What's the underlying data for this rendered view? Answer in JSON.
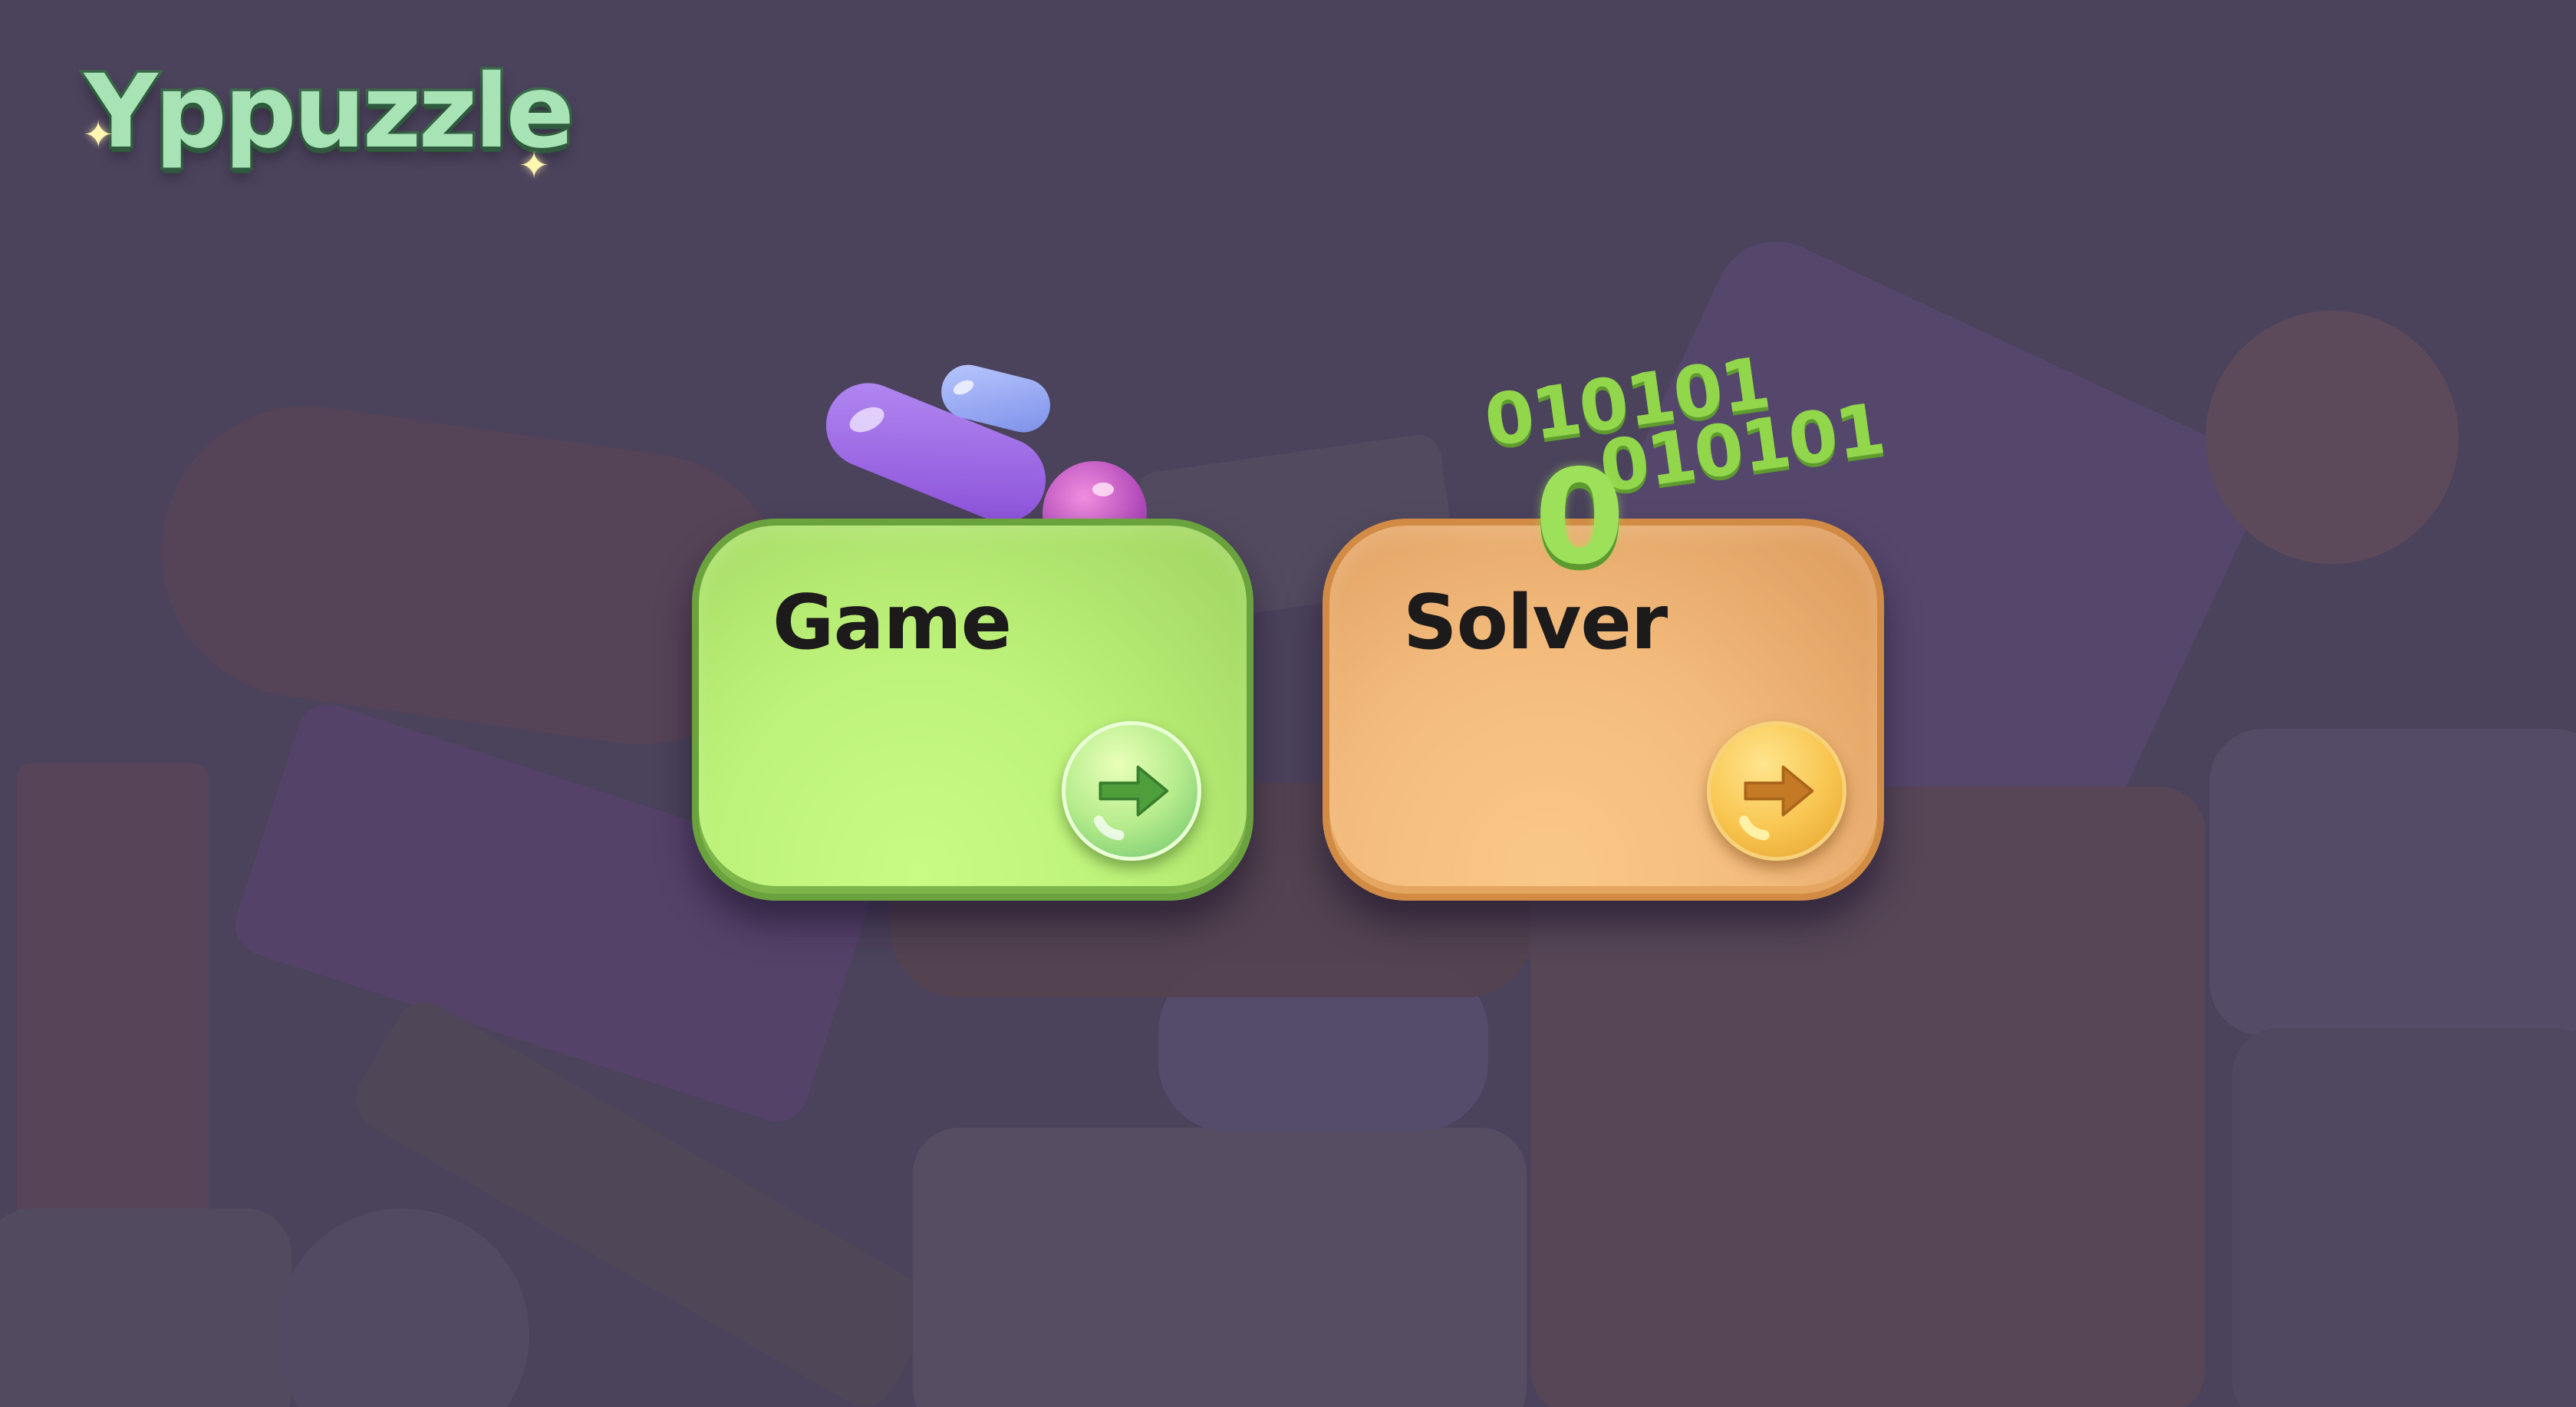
{
  "app": {
    "logo_text": "Yppuzzle"
  },
  "menu": {
    "cards": [
      {
        "id": "game",
        "label": "Game",
        "arrow_icon": "arrow-right-icon"
      },
      {
        "id": "solver",
        "label": "Solver",
        "arrow_icon": "arrow-right-icon"
      }
    ]
  },
  "decoration": {
    "binary_line_1": "010101",
    "binary_line_2": "010101",
    "binary_big_digit": "0"
  },
  "colors": {
    "background": "#4b425c",
    "game_card": "#bdf27a",
    "solver_card": "#f3bc7d",
    "logo": "#a7e3b5",
    "binary": "#92d64c"
  }
}
